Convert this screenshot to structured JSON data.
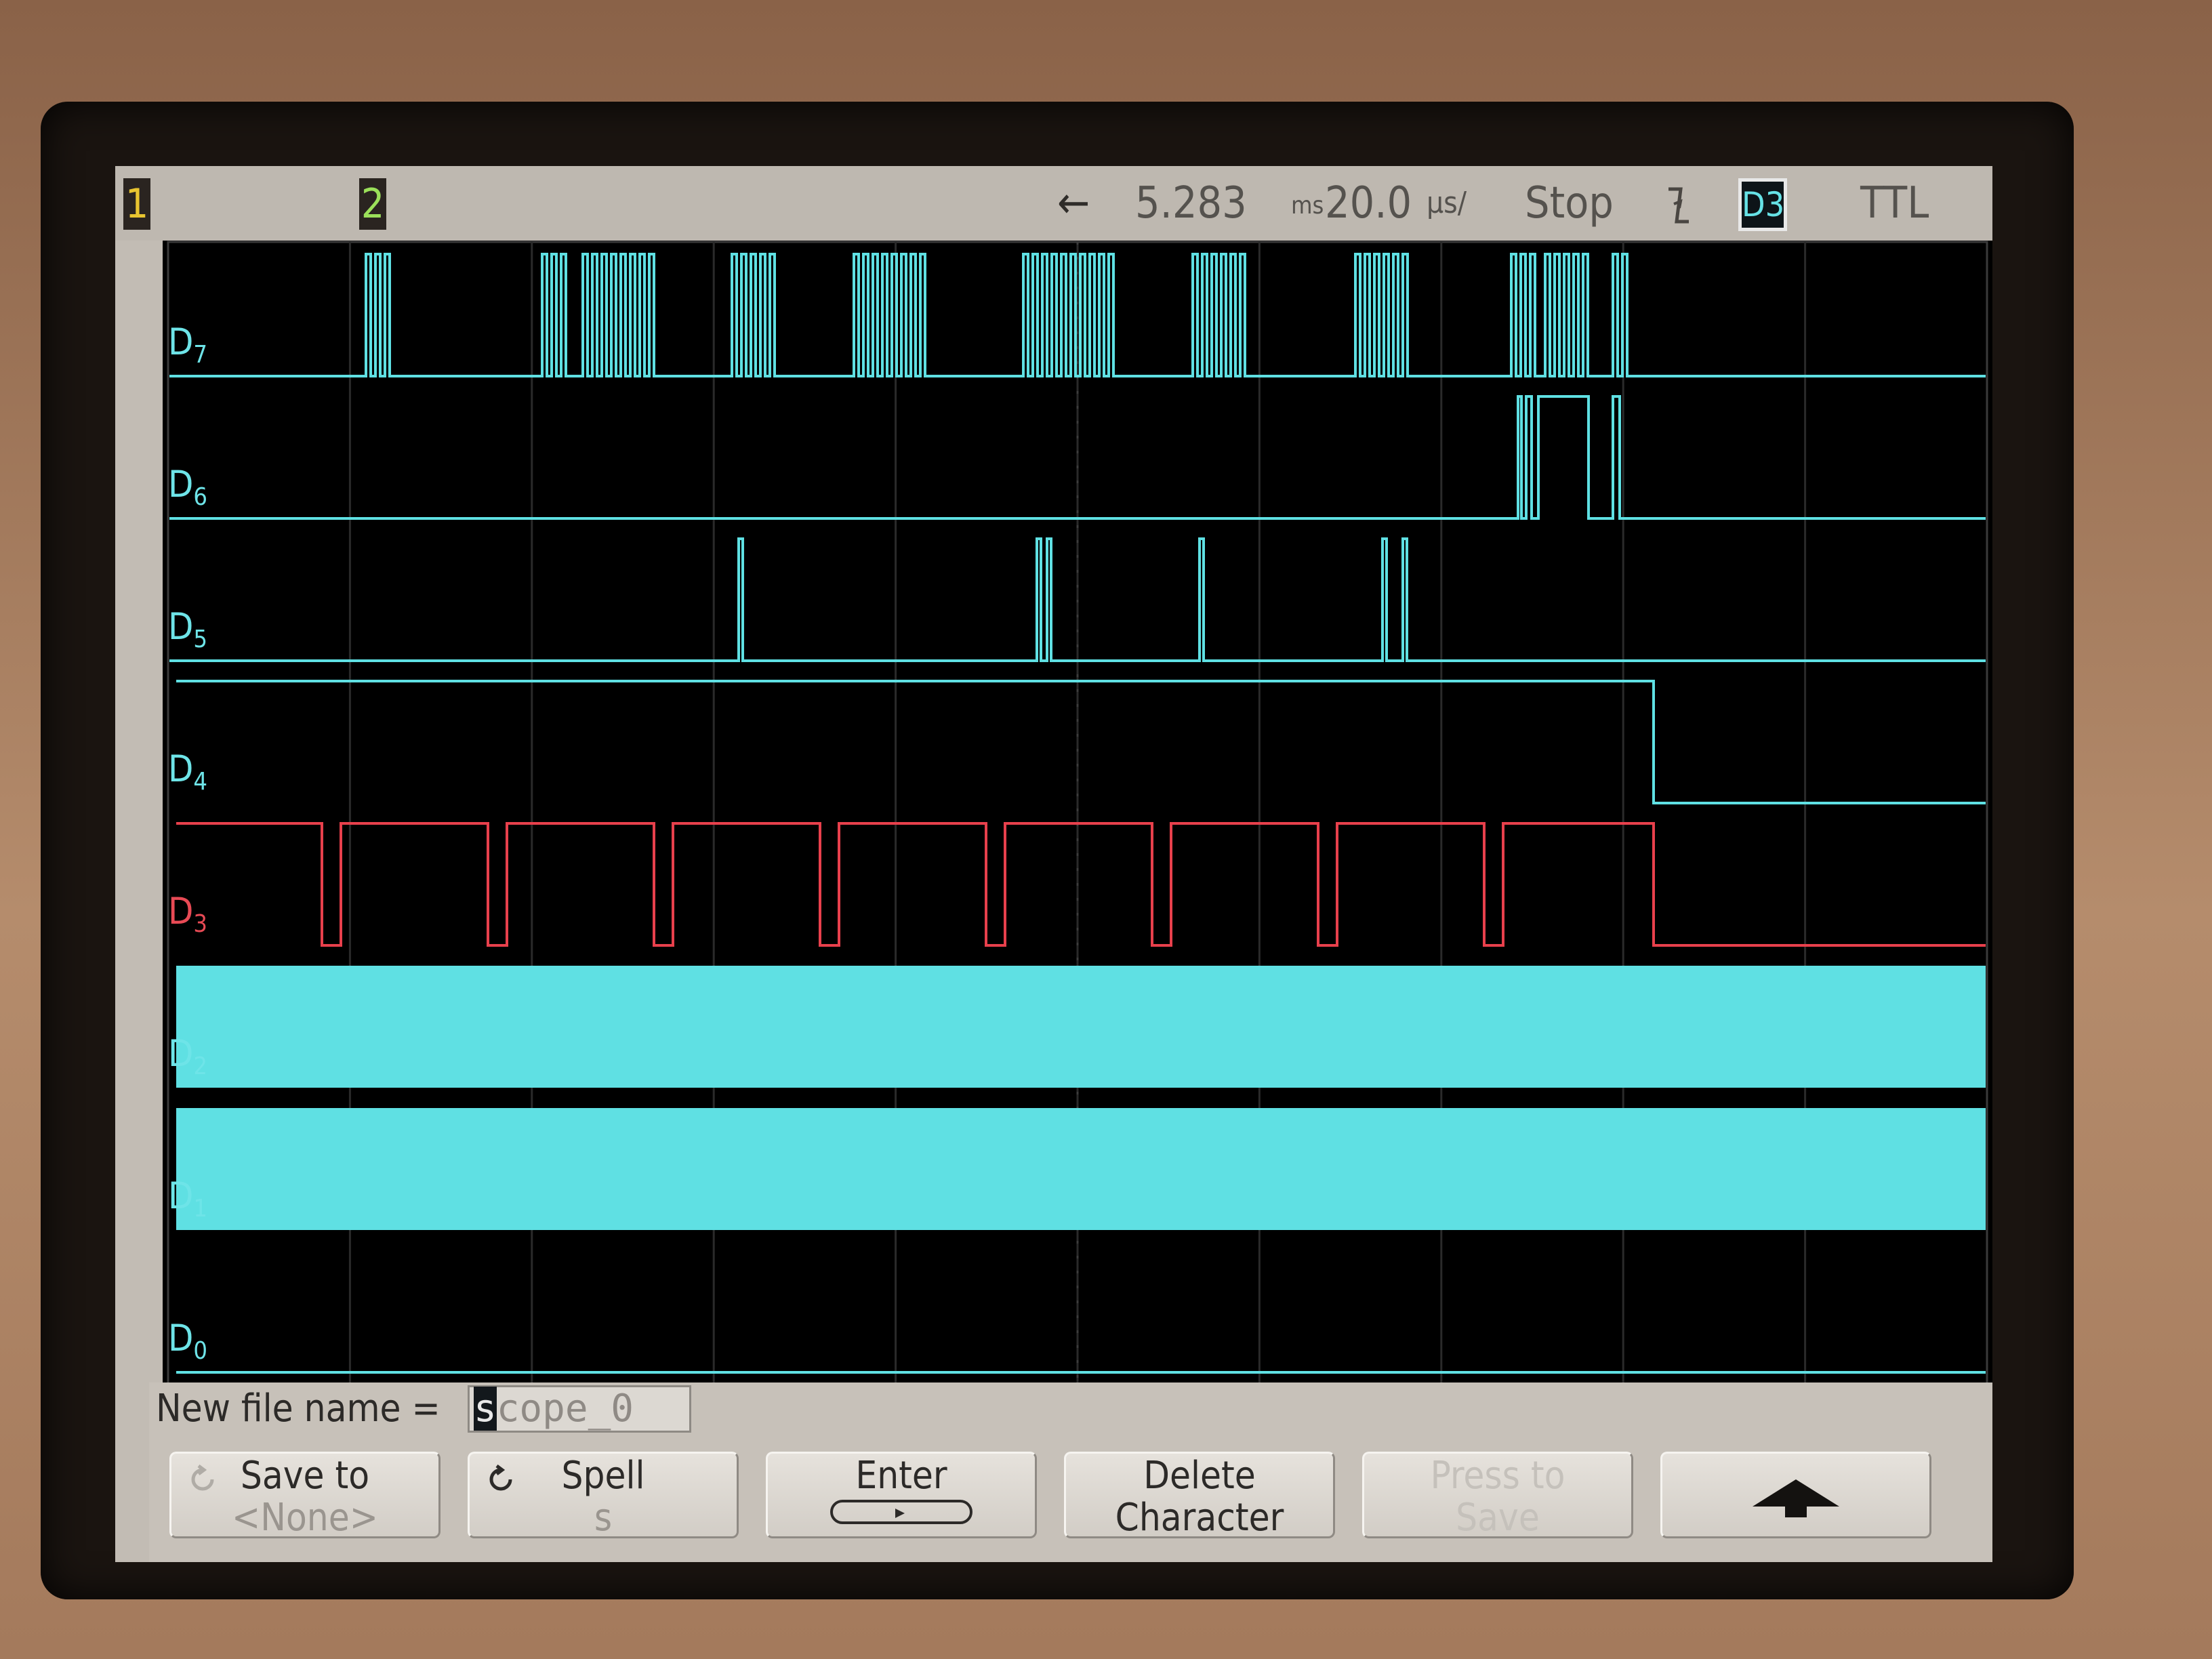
{
  "status_bar": {
    "marker1": "1",
    "marker2": "2",
    "arrow": "←",
    "delay": "5.283",
    "delay_unit": "ms",
    "timebase": "20.0",
    "timebase_unit": "µs/",
    "run_state": "Stop",
    "trigger_edge_icon": "falling-edge-icon",
    "trigger_source": "D3",
    "threshold": "TTL"
  },
  "channels": [
    {
      "id": "D7",
      "name": "D",
      "sub": "7",
      "color": "#5fe0e3"
    },
    {
      "id": "D6",
      "name": "D",
      "sub": "6",
      "color": "#5fe0e3"
    },
    {
      "id": "D5",
      "name": "D",
      "sub": "5",
      "color": "#5fe0e3"
    },
    {
      "id": "D4",
      "name": "D",
      "sub": "4",
      "color": "#5fe0e3"
    },
    {
      "id": "D3",
      "name": "D",
      "sub": "3",
      "color": "#e8404c"
    },
    {
      "id": "D2",
      "name": "D",
      "sub": "2",
      "color": "#5fe0e3"
    },
    {
      "id": "D1",
      "name": "D",
      "sub": "1",
      "color": "#5fe0e3"
    },
    {
      "id": "D0",
      "name": "D",
      "sub": "0",
      "color": "#5fe0e3"
    }
  ],
  "file_dialog": {
    "label": "New file name =",
    "value_first_char": "s",
    "value_rest": "cope_0"
  },
  "softkeys": {
    "save_to": {
      "line1": "Save to",
      "line2": "<None>"
    },
    "spell": {
      "line1": "Spell",
      "line2": "s"
    },
    "enter": {
      "line1": "Enter"
    },
    "delete": {
      "line1": "Delete",
      "line2": "Character"
    },
    "press_save": {
      "line1": "Press to",
      "line2": "Save"
    }
  },
  "colors": {
    "digital": "#5fe0e3",
    "trigger": "#e8404c",
    "background": "#000000"
  }
}
